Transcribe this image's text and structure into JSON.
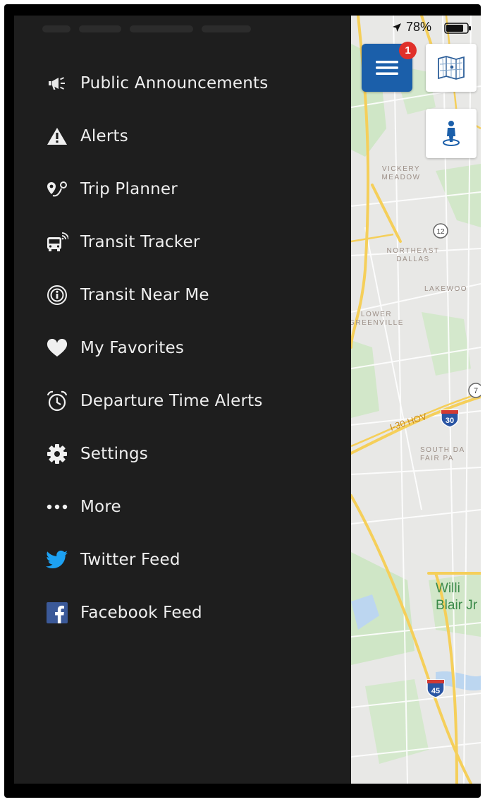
{
  "status_bar": {
    "battery_percent": "78%"
  },
  "menu": {
    "items": [
      {
        "label": "Public Announcements",
        "icon": "megaphone-icon"
      },
      {
        "label": "Alerts",
        "icon": "warning-icon"
      },
      {
        "label": "Trip Planner",
        "icon": "route-pin-icon"
      },
      {
        "label": "Transit Tracker",
        "icon": "bus-wifi-icon"
      },
      {
        "label": "Transit Near Me",
        "icon": "info-circle-icon"
      },
      {
        "label": "My Favorites",
        "icon": "heart-icon"
      },
      {
        "label": "Departure Time Alerts",
        "icon": "alarm-clock-icon"
      },
      {
        "label": "Settings",
        "icon": "gear-icon"
      },
      {
        "label": "More",
        "icon": "more-dots-icon"
      },
      {
        "label": "Twitter Feed",
        "icon": "twitter-icon"
      },
      {
        "label": "Facebook Feed",
        "icon": "facebook-icon"
      }
    ]
  },
  "map": {
    "notification_count": "1",
    "labels": {
      "vickery": "VICKERY\nMEADOW",
      "northeast": "NORTHEAST\nDALLAS",
      "lakewood": "LAKEWOO",
      "lower": "LOWER\nGREENVILLE",
      "south": "SOUTH DA\nFAIR PA",
      "route_hov": "I-30 HOV",
      "shield_12": "12",
      "shield_30": "30",
      "shield_45": "45",
      "shield_7": "7",
      "poi": "Willi\nBlair Jr"
    }
  },
  "colors": {
    "drawer_bg": "#1e1e1e",
    "menu_button": "#1b5faa",
    "badge": "#e0302a",
    "twitter": "#1da1f2",
    "facebook": "#3b5998",
    "road": "#f5cf5a"
  }
}
